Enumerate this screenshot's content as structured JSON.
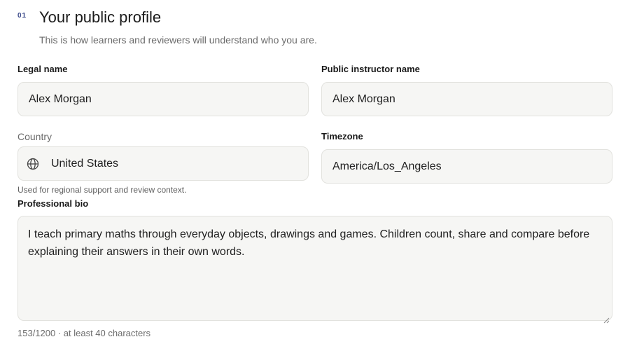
{
  "section": {
    "number": "01",
    "title": "Your public profile",
    "subtitle": "This is how learners and reviewers will understand who you are."
  },
  "legal_name": {
    "label": "Legal name",
    "value": "Alex Morgan"
  },
  "public_name": {
    "label": "Public instructor name",
    "value": "Alex Morgan"
  },
  "country": {
    "label": "Country",
    "value": "United States",
    "icon": "globe-icon",
    "hint": "Used for regional support and review context."
  },
  "timezone": {
    "label": "Timezone",
    "value": "America/Los_Angeles"
  },
  "bio": {
    "label": "Professional bio",
    "value": "I teach primary maths through everyday objects, drawings and games. Children count, share and compare before explaining their answers in their own words.",
    "counter": "153/1200 · at least 40 characters"
  }
}
